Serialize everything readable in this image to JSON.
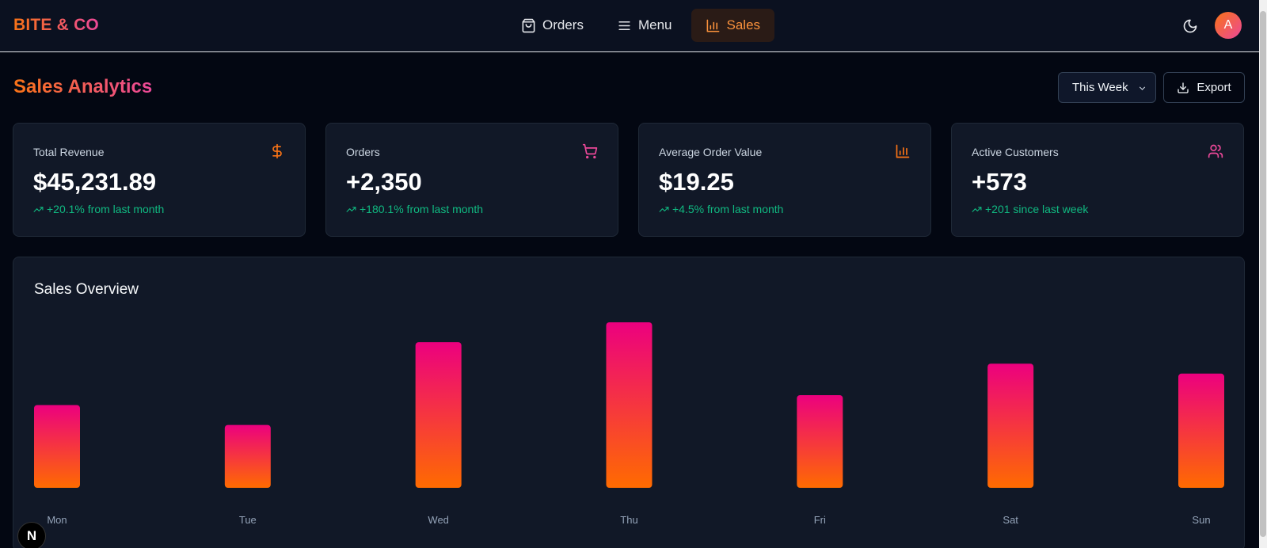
{
  "app": {
    "brand": "BITE & CO"
  },
  "nav": {
    "items": [
      {
        "label": "Orders",
        "icon": "shopping-bag-icon",
        "active": false
      },
      {
        "label": "Menu",
        "icon": "menu-icon",
        "active": false
      },
      {
        "label": "Sales",
        "icon": "bar-chart-icon",
        "active": true
      }
    ],
    "avatar_initial": "A",
    "theme_icon": "moon-icon"
  },
  "page": {
    "title": "Sales Analytics",
    "period_select": {
      "value": "This Week"
    },
    "export_label": "Export"
  },
  "stats": [
    {
      "label": "Total Revenue",
      "value": "$45,231.89",
      "change": "+20.1% from last month",
      "icon": "dollar-icon",
      "icon_color": "#f97316"
    },
    {
      "label": "Orders",
      "value": "+2,350",
      "change": "+180.1% from last month",
      "icon": "cart-icon",
      "icon_color": "#ec4899"
    },
    {
      "label": "Average Order Value",
      "value": "$19.25",
      "change": "+4.5% from last month",
      "icon": "bar-chart-icon",
      "icon_color": "#f97316"
    },
    {
      "label": "Active Customers",
      "value": "+573",
      "change": "+201 since last week",
      "icon": "users-icon",
      "icon_color": "#ec4899"
    }
  ],
  "colors": {
    "accent_orange": "#f97316",
    "accent_pink": "#ec4899",
    "positive_green": "#10b981",
    "bar_gradient_top": "#ec007f",
    "bar_gradient_bottom": "#ff6b00"
  },
  "chart_data": {
    "type": "bar",
    "title": "Sales Overview",
    "categories": [
      "Mon",
      "Tue",
      "Wed",
      "Thu",
      "Fri",
      "Sat",
      "Sun"
    ],
    "values": [
      0.5,
      0.38,
      0.88,
      1.0,
      0.56,
      0.75,
      0.69
    ],
    "ylim": [
      0,
      1
    ],
    "grid": false,
    "xlabel": "",
    "ylabel": ""
  }
}
